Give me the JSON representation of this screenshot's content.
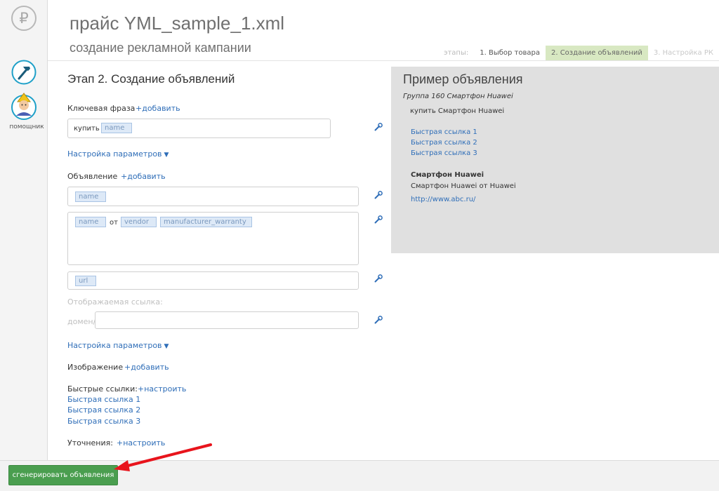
{
  "sidebar": {
    "currency_glyph": "₽",
    "tools_icon": "hammer-icon",
    "helper_icon": "assistant-avatar-icon",
    "helper_label": "помощник"
  },
  "header": {
    "title": "прайс YML_sample_1.xml",
    "subtitle": "создание рекламной кампании",
    "steps_label": "этапы:",
    "steps": [
      {
        "label": "1. Выбор товара",
        "state": "done"
      },
      {
        "label": "2. Создание объявлений",
        "state": "active"
      },
      {
        "label": "3. Настройка РК",
        "state": "disabled"
      }
    ]
  },
  "form": {
    "stage_title": "Этап 2. Создание объявлений",
    "keyword": {
      "label": "Ключевая фраза",
      "add_link": "+добавить",
      "prefix": "купить",
      "tag": "name"
    },
    "params_link_1": "Настройка параметров",
    "ad": {
      "label": "Объявление",
      "add_link": "+добавить",
      "title_tag": "name",
      "body_tag_1": "name",
      "body_word": "от",
      "body_tag_2": "vendor",
      "body_tag_3": "manufacturer_warranty",
      "url_tag": "url"
    },
    "display_link_label": "Отображаемая ссылка:",
    "domain_prefix": "домен/",
    "display_link_value": "",
    "params_link_2": "Настройка параметров",
    "image": {
      "label": "Изображение",
      "add_link": "+добавить"
    },
    "quick_links": {
      "label": "Быстрые ссылки:",
      "setup_link": "+настроить",
      "items": [
        "Быстрая ссылка 1",
        "Быстрая ссылка 2",
        "Быстрая ссылка 3"
      ]
    },
    "callouts": {
      "label": "Уточнения:",
      "setup_link": "+настроить"
    }
  },
  "preview": {
    "title": "Пример объявления",
    "group": "Группа 160 Смартфон Huawei",
    "keyword": "купить Смартфон Huawei",
    "quick_links": [
      "Быстрая ссылка 1",
      "Быстрая ссылка 2",
      "Быстрая ссылка 3"
    ],
    "ad_title": "Смартфон Huawei",
    "ad_text": "Смартфон Huawei от Huawei",
    "ad_url": "http://www.abc.ru/"
  },
  "footer": {
    "generate_button": "сгенерировать объявления"
  },
  "colors": {
    "link": "#2f6eb8",
    "active_step": "#d8e8c2",
    "button_green": "#4a9e4f",
    "annotation_arrow": "#e8141c"
  }
}
